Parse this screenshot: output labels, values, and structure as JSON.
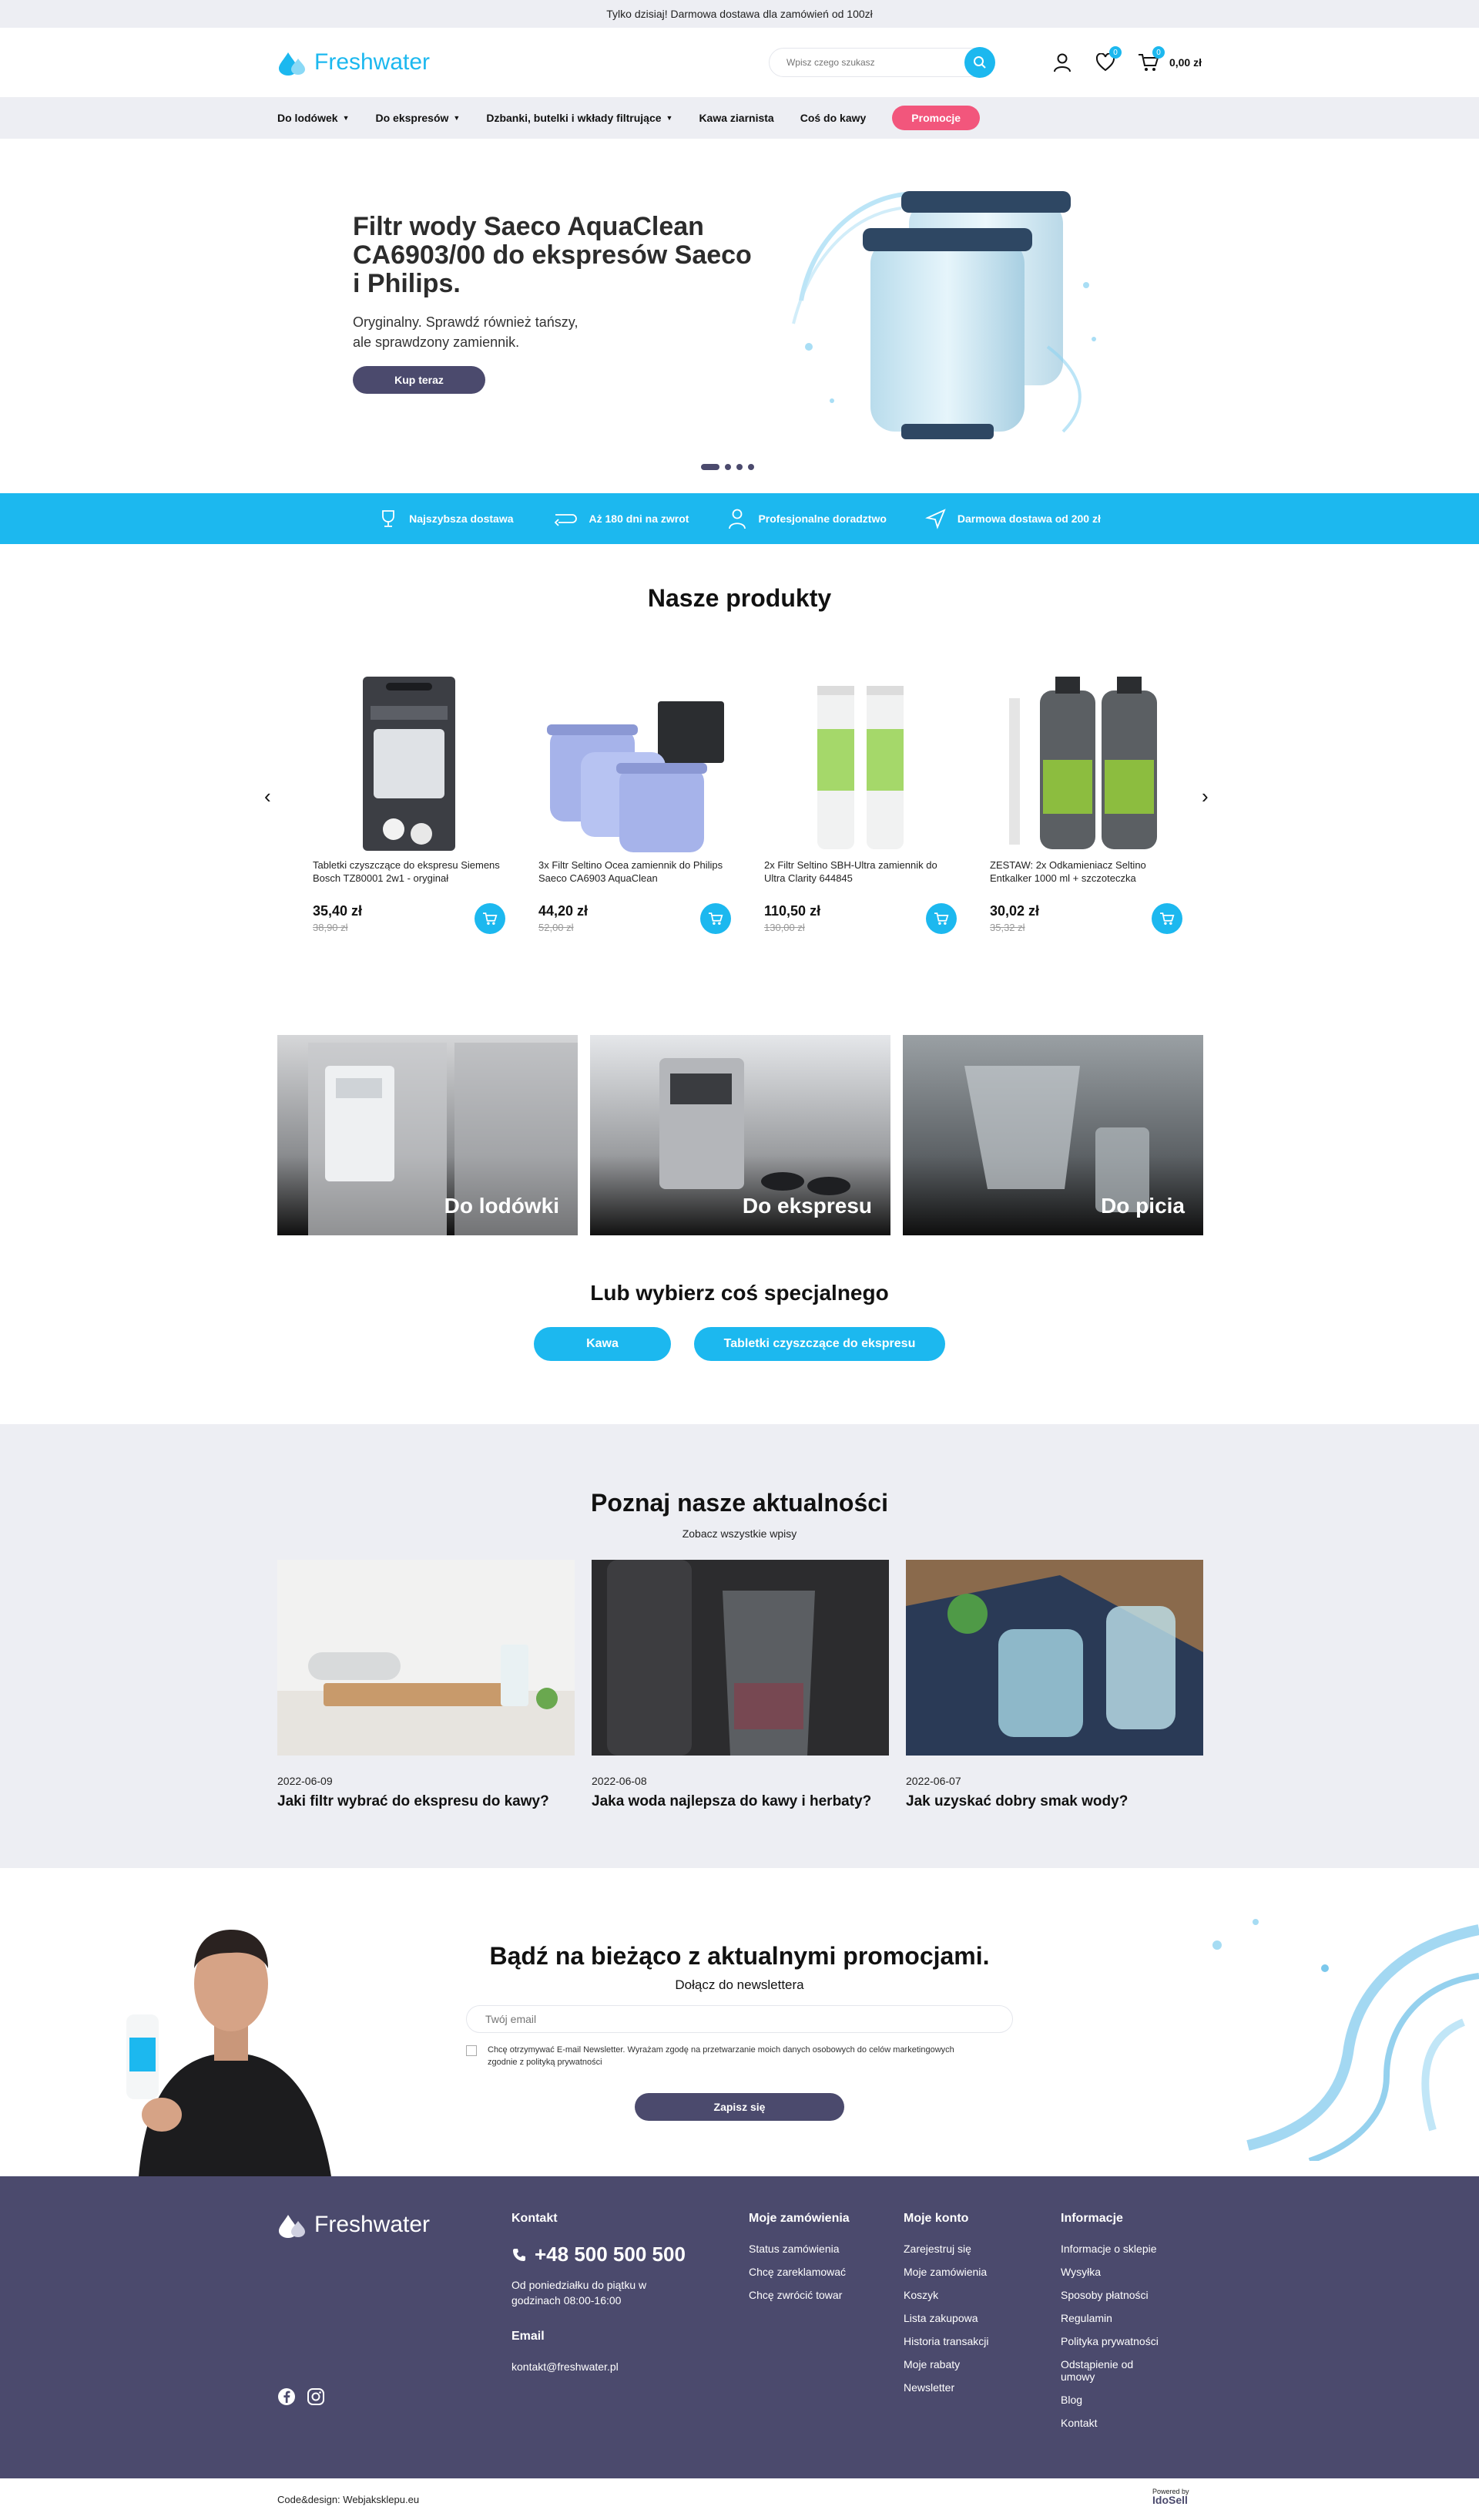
{
  "topbar": {
    "text": "Tylko dzisiaj! Darmowa dostawa dla zamówień od 100zł"
  },
  "header": {
    "logo": "Freshwater",
    "search_placeholder": "Wpisz czego szukasz",
    "wishlist_count": "0",
    "cart_count": "0",
    "cart_total": "0,00 zł"
  },
  "nav": {
    "items": [
      {
        "label": "Do lodówek"
      },
      {
        "label": "Do ekspresów"
      },
      {
        "label": "Dzbanki, butelki i wkłady filtrujące"
      },
      {
        "label": "Kawa ziarnista"
      },
      {
        "label": "Coś do kawy"
      }
    ],
    "promo": "Promocje"
  },
  "hero": {
    "title": "Filtr wody Saeco AquaClean CA6903/00 do ekspresów Saeco i Philips.",
    "subtitle": "Oryginalny. Sprawdź również tańszy, ale sprawdzony zamiennik.",
    "button": "Kup teraz"
  },
  "benefits": [
    {
      "label": "Najszybsza dostawa",
      "icon": "trophy-icon"
    },
    {
      "label": "Aż 180 dni na zwrot",
      "icon": "return-icon"
    },
    {
      "label": "Profesjonalne doradztwo",
      "icon": "person-icon"
    },
    {
      "label": "Darmowa dostawa od 200 zł",
      "icon": "send-icon"
    }
  ],
  "products": {
    "title": "Nasze produkty",
    "items": [
      {
        "name": "Tabletki czyszczące do ekspresu Siemens Bosch TZ80001 2w1 - oryginał",
        "price": "35,40 zł",
        "old_price": "38,90 zł"
      },
      {
        "name": "3x Filtr Seltino Ocea zamiennik do Philips Saeco CA6903 AquaClean",
        "price": "44,20 zł",
        "old_price": "52,00 zł"
      },
      {
        "name": "2x Filtr Seltino SBH-Ultra zamiennik do Ultra Clarity 644845",
        "price": "110,50 zł",
        "old_price": "130,00 zł"
      },
      {
        "name": "ZESTAW: 2x Odkamieniacz Seltino Entkalker 1000 ml + szczoteczka",
        "price": "30,02 zł",
        "old_price": "35,32 zł"
      }
    ]
  },
  "categories": [
    {
      "label": "Do lodówki"
    },
    {
      "label": "Do ekspresu"
    },
    {
      "label": "Do picia"
    }
  ],
  "special": {
    "title": "Lub wybierz coś specjalnego",
    "tags": [
      "Kawa",
      "Tabletki czyszczące do ekspresu"
    ]
  },
  "news": {
    "title": "Poznaj nasze aktualności",
    "all_link": "Zobacz wszystkie wpisy",
    "posts": [
      {
        "date": "2022-06-09",
        "title": "Jaki filtr wybrać do ekspresu do kawy?"
      },
      {
        "date": "2022-06-08",
        "title": "Jaka woda najlepsza do kawy i herbaty?"
      },
      {
        "date": "2022-06-07",
        "title": "Jak uzyskać dobry smak wody?"
      }
    ]
  },
  "newsletter": {
    "title": "Bądź na bieżąco z aktualnymi promocjami.",
    "subtitle": "Dołącz do newslettera",
    "email_placeholder": "Twój email",
    "consent": "Chcę otrzymywać E-mail Newsletter. Wyrażam zgodę na przetwarzanie moich danych osobowych do celów marketingowych zgodnie z polityką prywatności",
    "button": "Zapisz się"
  },
  "footer": {
    "logo": "Freshwater",
    "contact_title": "Kontakt",
    "phone": "+48 500 500 500",
    "hours": "Od poniedziałku do piątku w godzinach 08:00-16:00",
    "email_title": "Email",
    "email": "kontakt@freshwater.pl",
    "orders_title": "Moje zamówienia",
    "orders_links": [
      "Status zamówienia",
      "Chcę zareklamować",
      "Chcę zwrócić towar"
    ],
    "account_title": "Moje konto",
    "account_links": [
      "Zarejestruj się",
      "Moje zamówienia",
      "Koszyk",
      "Lista zakupowa",
      "Historia transakcji",
      "Moje rabaty",
      "Newsletter"
    ],
    "info_title": "Informacje",
    "info_links": [
      "Informacje o sklepie",
      "Wysyłka",
      "Sposoby płatności",
      "Regulamin",
      "Polityka prywatności",
      "Odstąpienie od umowy",
      "Blog",
      "Kontakt"
    ]
  },
  "bottom": {
    "credit": "Code&design: Webjaksklepu.eu",
    "powered": "Powered by",
    "powered_brand": "IdoSell"
  },
  "colors": {
    "accent": "#1cb8ef",
    "dark": "#4b4a6d",
    "promo": "#f2567c",
    "light_bg": "#edeef3"
  }
}
